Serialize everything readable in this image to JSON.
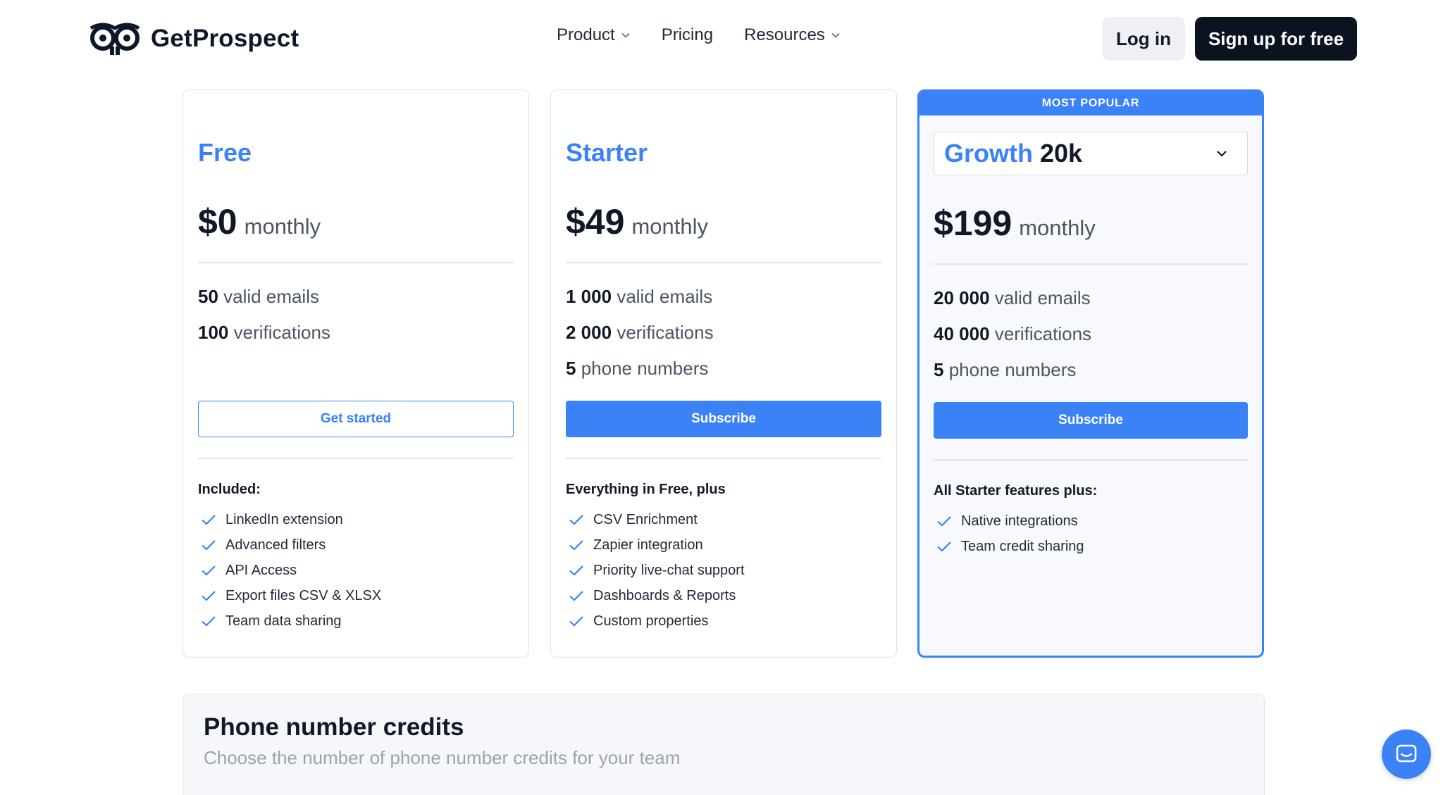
{
  "header": {
    "logo_text": "GetProspect",
    "nav": [
      {
        "label": "Product",
        "has_dropdown": true
      },
      {
        "label": "Pricing",
        "has_dropdown": false
      },
      {
        "label": "Resources",
        "has_dropdown": true
      }
    ],
    "login_label": "Log in",
    "signup_label": "Sign up for free"
  },
  "plans": [
    {
      "name": "Free",
      "price": "$0",
      "period": "monthly",
      "quotas": [
        {
          "value": "50",
          "label": "valid emails"
        },
        {
          "value": "100",
          "label": "verifications"
        }
      ],
      "cta": "Get started",
      "features_heading": "Included:",
      "features": [
        "LinkedIn extension",
        "Advanced filters",
        "API Access",
        "Export files CSV & XLSX",
        "Team data sharing"
      ]
    },
    {
      "name": "Starter",
      "price": "$49",
      "period": "monthly",
      "quotas": [
        {
          "value": "1 000",
          "label": "valid emails"
        },
        {
          "value": "2 000",
          "label": "verifications"
        },
        {
          "value": "5",
          "label": "phone numbers"
        }
      ],
      "cta": "Subscribe",
      "features_heading": "Everything in Free, plus",
      "features": [
        "CSV Enrichment",
        "Zapier integration",
        "Priority live-chat support",
        "Dashboards & Reports",
        "Custom properties"
      ]
    },
    {
      "badge": "MOST POPULAR",
      "name": "Growth",
      "volume": "20k",
      "price": "$199",
      "period": "monthly",
      "quotas": [
        {
          "value": "20 000",
          "label": "valid emails"
        },
        {
          "value": "40 000",
          "label": "verifications"
        },
        {
          "value": "5",
          "label": "phone numbers"
        }
      ],
      "cta": "Subscribe",
      "features_heading": "All Starter features plus:",
      "features": [
        "Native integrations",
        "Team credit sharing"
      ]
    }
  ],
  "phone_credits": {
    "title": "Phone number credits",
    "subtitle": "Choose the number of phone number credits for your team"
  },
  "colors": {
    "accent": "#3b82f6",
    "dark": "#0b1220",
    "muted": "#4b5563"
  },
  "icons": [
    "logo-mark-icon",
    "chevron-down-icon",
    "check-icon",
    "chat-icon"
  ]
}
